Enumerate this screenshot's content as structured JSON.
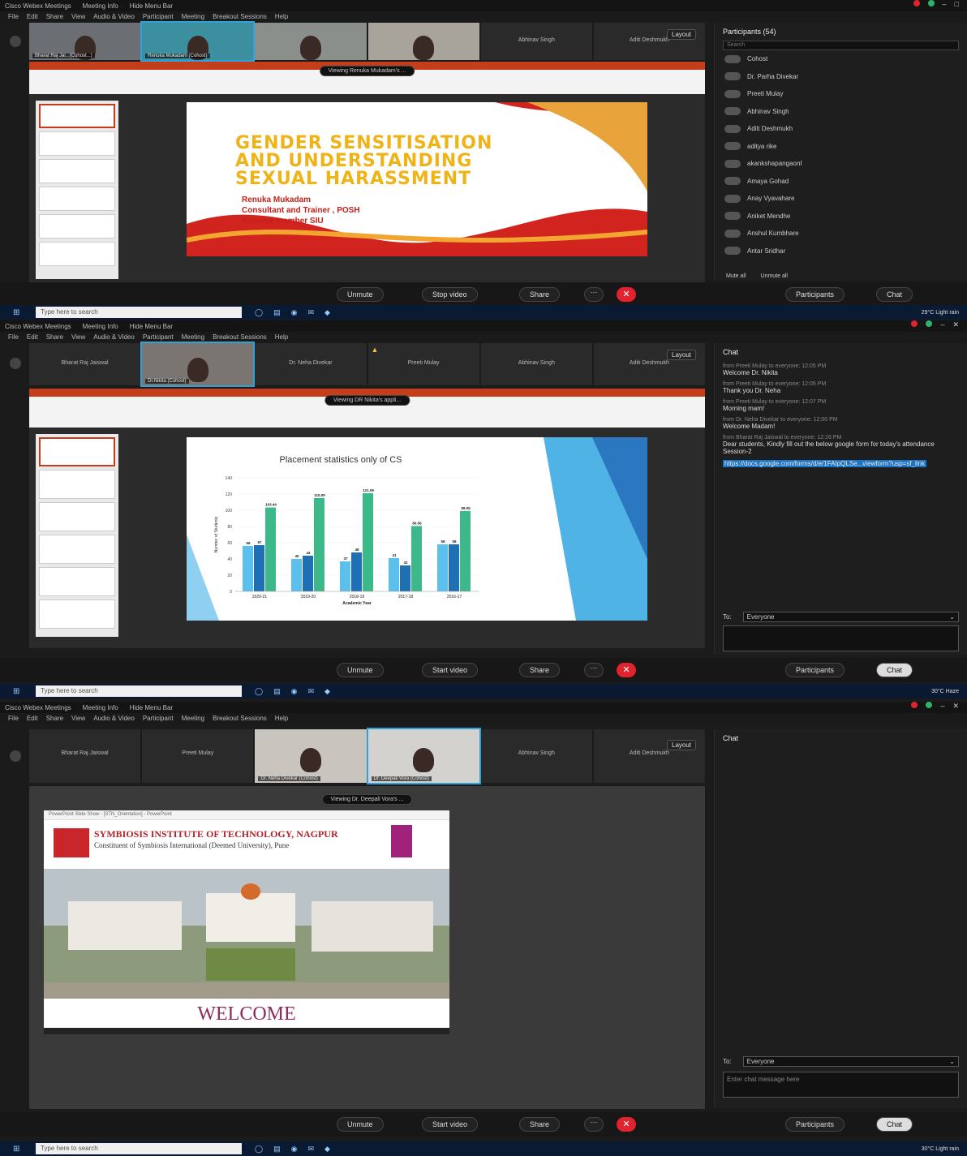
{
  "app": {
    "title": "Cisco Webex Meetings",
    "meeting_info": "Meeting Info",
    "hide_menu_bar": "Hide Menu Bar",
    "menu": [
      "File",
      "Edit",
      "Share",
      "View",
      "Audio & Video",
      "Participant",
      "Meeting",
      "Breakout Sessions",
      "Help"
    ],
    "layout_label": "Layout"
  },
  "taskbar": {
    "search_placeholder": "Type here to search",
    "weather1": "29°C Light rain",
    "weather2": "30°C Haze",
    "weather3": "30°C Light rain"
  },
  "panel1": {
    "tiles": [
      "Bharat Raj Jai...(Cohost...)",
      "Renuka Mukadam (Cohost)",
      "",
      "",
      "Abhinav Singh",
      "Aditi Deshmukh"
    ],
    "viewing": "Viewing Renuka Mukadam's ...",
    "slide": {
      "title_lines": [
        "GENDER SENSITISATION",
        "AND UNDERSTANDING",
        "SEXUAL HARASSMENT"
      ],
      "author": "Renuka Mukadam",
      "role": "Consultant and Trainer , POSH",
      "org": "External member SIU"
    },
    "participants_header": "Participants (54)",
    "search_placeholder": "Search",
    "participants": [
      {
        "name": "Cohost",
        "sub": ""
      },
      {
        "name": "Dr. Parha Divekar",
        "sub": "Cohost"
      },
      {
        "name": "Preeti Mulay",
        "sub": "Cohost"
      },
      {
        "name": "Abhinav Singh",
        "sub": ""
      },
      {
        "name": "Aditi Deshmukh",
        "sub": ""
      },
      {
        "name": "aditya rike",
        "sub": ""
      },
      {
        "name": "akankshapangaonI",
        "sub": ""
      },
      {
        "name": "Amaya Gohad",
        "sub": ""
      },
      {
        "name": "Anay Vyavahare",
        "sub": ""
      },
      {
        "name": "Aniket Mendhe",
        "sub": ""
      },
      {
        "name": "Anshul Kumbhare",
        "sub": ""
      },
      {
        "name": "Antar Sridhar",
        "sub": ""
      }
    ],
    "mute_all": "Mute all",
    "unmute_all": "Unmute all",
    "controls": {
      "unmute": "Unmute",
      "video": "Stop video",
      "share": "Share",
      "participants": "Participants",
      "chat": "Chat"
    }
  },
  "panel2": {
    "tiles": [
      "Bharat Raj Jaiswal",
      "Dr.Nikita (Cohost)",
      "Dr. Neha Divekar",
      "Preeti Mulay",
      "Abhinav Singh",
      "Aditi Deshmukh"
    ],
    "viewing": "Viewing DR Nikita's appli...",
    "chat_header": "Chat",
    "chat": [
      {
        "from": "from Preeti Mulay to everyone:   12:05 PM",
        "text": "Welcome Dr. Nikita"
      },
      {
        "from": "from Preeti Mulay to everyone:   12:05 PM",
        "text": "Thank you Dr. Neha"
      },
      {
        "from": "from Preeti Mulay to everyone:   12:07 PM",
        "text": "Morning mam!"
      },
      {
        "from": "from Dr. Neha Divekar to everyone:   12:00 PM",
        "text": "Welcome Madam!"
      },
      {
        "from": "from Bharat Raj Jaiswal to everyone:   12:16 PM",
        "text": "Dear students, Kindly fill out the below google form for today's attendance Session-2"
      }
    ],
    "chat_link": "https://docs.google.com/forms/d/e/1FAIpQLSe...viewform?usp=sf_link",
    "to_label": "To:",
    "to_value": "Everyone",
    "controls": {
      "unmute": "Unmute",
      "video": "Start video",
      "share": "Share",
      "participants": "Participants",
      "chat": "Chat"
    },
    "slide_title": "Placement statistics only of CS"
  },
  "panel3": {
    "tiles": [
      "Bharat Raj Jaiswal",
      "Preeti Mulay",
      "Dr. Neha Divekar (Cohost)",
      "Dr. Deepali Vora (Cohost)",
      "Abhinav Singh",
      "Aditi Deshmukh"
    ],
    "viewing": "Viewing Dr. Deepali Vora's ...",
    "pp_window_title": "PowerPoint Slide Show - [STN_Orientation] - PowerPoint",
    "institute": "SYMBIOSIS INSTITUTE OF TECHNOLOGY, NAGPUR",
    "constituent": "Constituent of Symbiosis International (Deemed University), Pune",
    "welcome": "WELCOME",
    "chat_header": "Chat",
    "to_label": "To:",
    "to_value": "Everyone",
    "chat_placeholder": "Enter chat message here",
    "controls": {
      "unmute": "Unmute",
      "video": "Start video",
      "share": "Share",
      "participants": "Participants",
      "chat": "Chat"
    }
  },
  "chart_data": {
    "type": "bar",
    "title": "Placement statistics only of CS",
    "xlabel": "Academic Year",
    "ylabel": "Number of Students",
    "categories": [
      "2020-21",
      "2019-20",
      "2018-19",
      "2017-18",
      "2016-17"
    ],
    "series": [
      {
        "name": "",
        "values": [
          56,
          40,
          37,
          41,
          58
        ]
      },
      {
        "name": "",
        "values": [
          57,
          44,
          48,
          32,
          58
        ]
      },
      {
        "name": "",
        "values": [
          103.44,
          115.09,
          121.09,
          80.56,
          99.05
        ]
      }
    ],
    "ylim": [
      0,
      140
    ],
    "colors": [
      "#5bc0eb",
      "#1f6fb5",
      "#3db88b"
    ]
  }
}
